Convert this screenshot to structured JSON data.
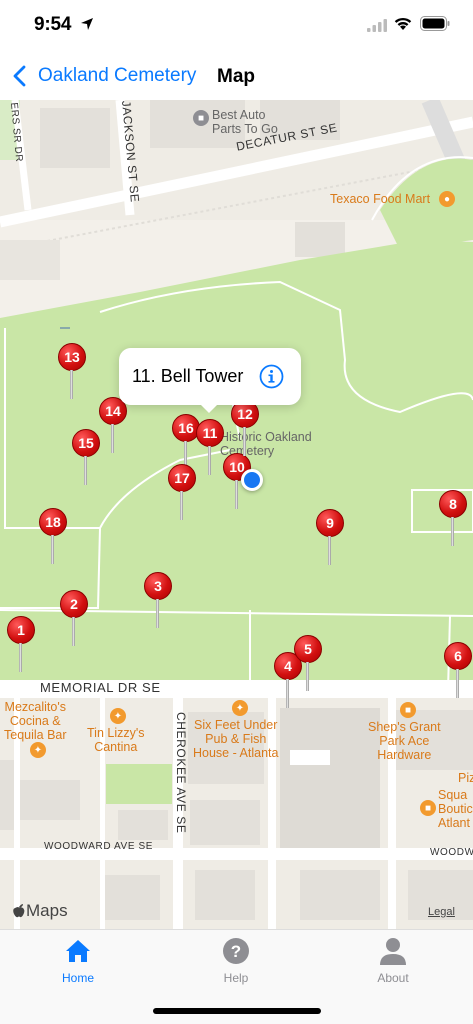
{
  "status_bar": {
    "time": "9:54"
  },
  "nav": {
    "back_label": "Oakland Cemetery",
    "title": "Map"
  },
  "map": {
    "roads": {
      "decatur": "DECATUR ST SE",
      "memorial": "MEMORIAL DR SE",
      "jackson": "JACKSON ST SE",
      "cherokee": "CHEROKEE AVE SE",
      "woodward": "WOODWARD AVE SE",
      "woodward_right": "WOODW",
      "rogers": "ERS SR DR"
    },
    "pois": {
      "best_auto": "Best Auto\nParts To Go",
      "texaco": "Texaco Food Mart",
      "mezcalito": "Mezcalito's\nCocina &\nTequila Bar",
      "tin_lizzy": "Tin Lizzy's\nCantina",
      "six_feet": "Six Feet Under\nPub & Fish\nHouse - Atlanta",
      "sheps": "Shep's Grant\nPark Ace\nHardware",
      "squash": "Squa\nBoutic\nAtlant",
      "piz": "Piz",
      "cemetery": "Historic Oakland\nCemetery"
    },
    "pins": [
      "1",
      "2",
      "3",
      "4",
      "5",
      "6",
      "8",
      "9",
      "10",
      "11",
      "12",
      "13",
      "14",
      "15",
      "16",
      "17",
      "18"
    ],
    "callout": "11. Bell Tower",
    "attribution": "Maps",
    "legal": "Legal"
  },
  "tabs": [
    {
      "label": "Home",
      "icon": "house-icon",
      "active": true
    },
    {
      "label": "Help",
      "icon": "question-icon",
      "active": false
    },
    {
      "label": "About",
      "icon": "person-icon",
      "active": false
    }
  ],
  "colors": {
    "accent": "#0a7aff",
    "park": "#c9e6a6",
    "pin": "#d21010",
    "inactive": "#8e8e93"
  }
}
